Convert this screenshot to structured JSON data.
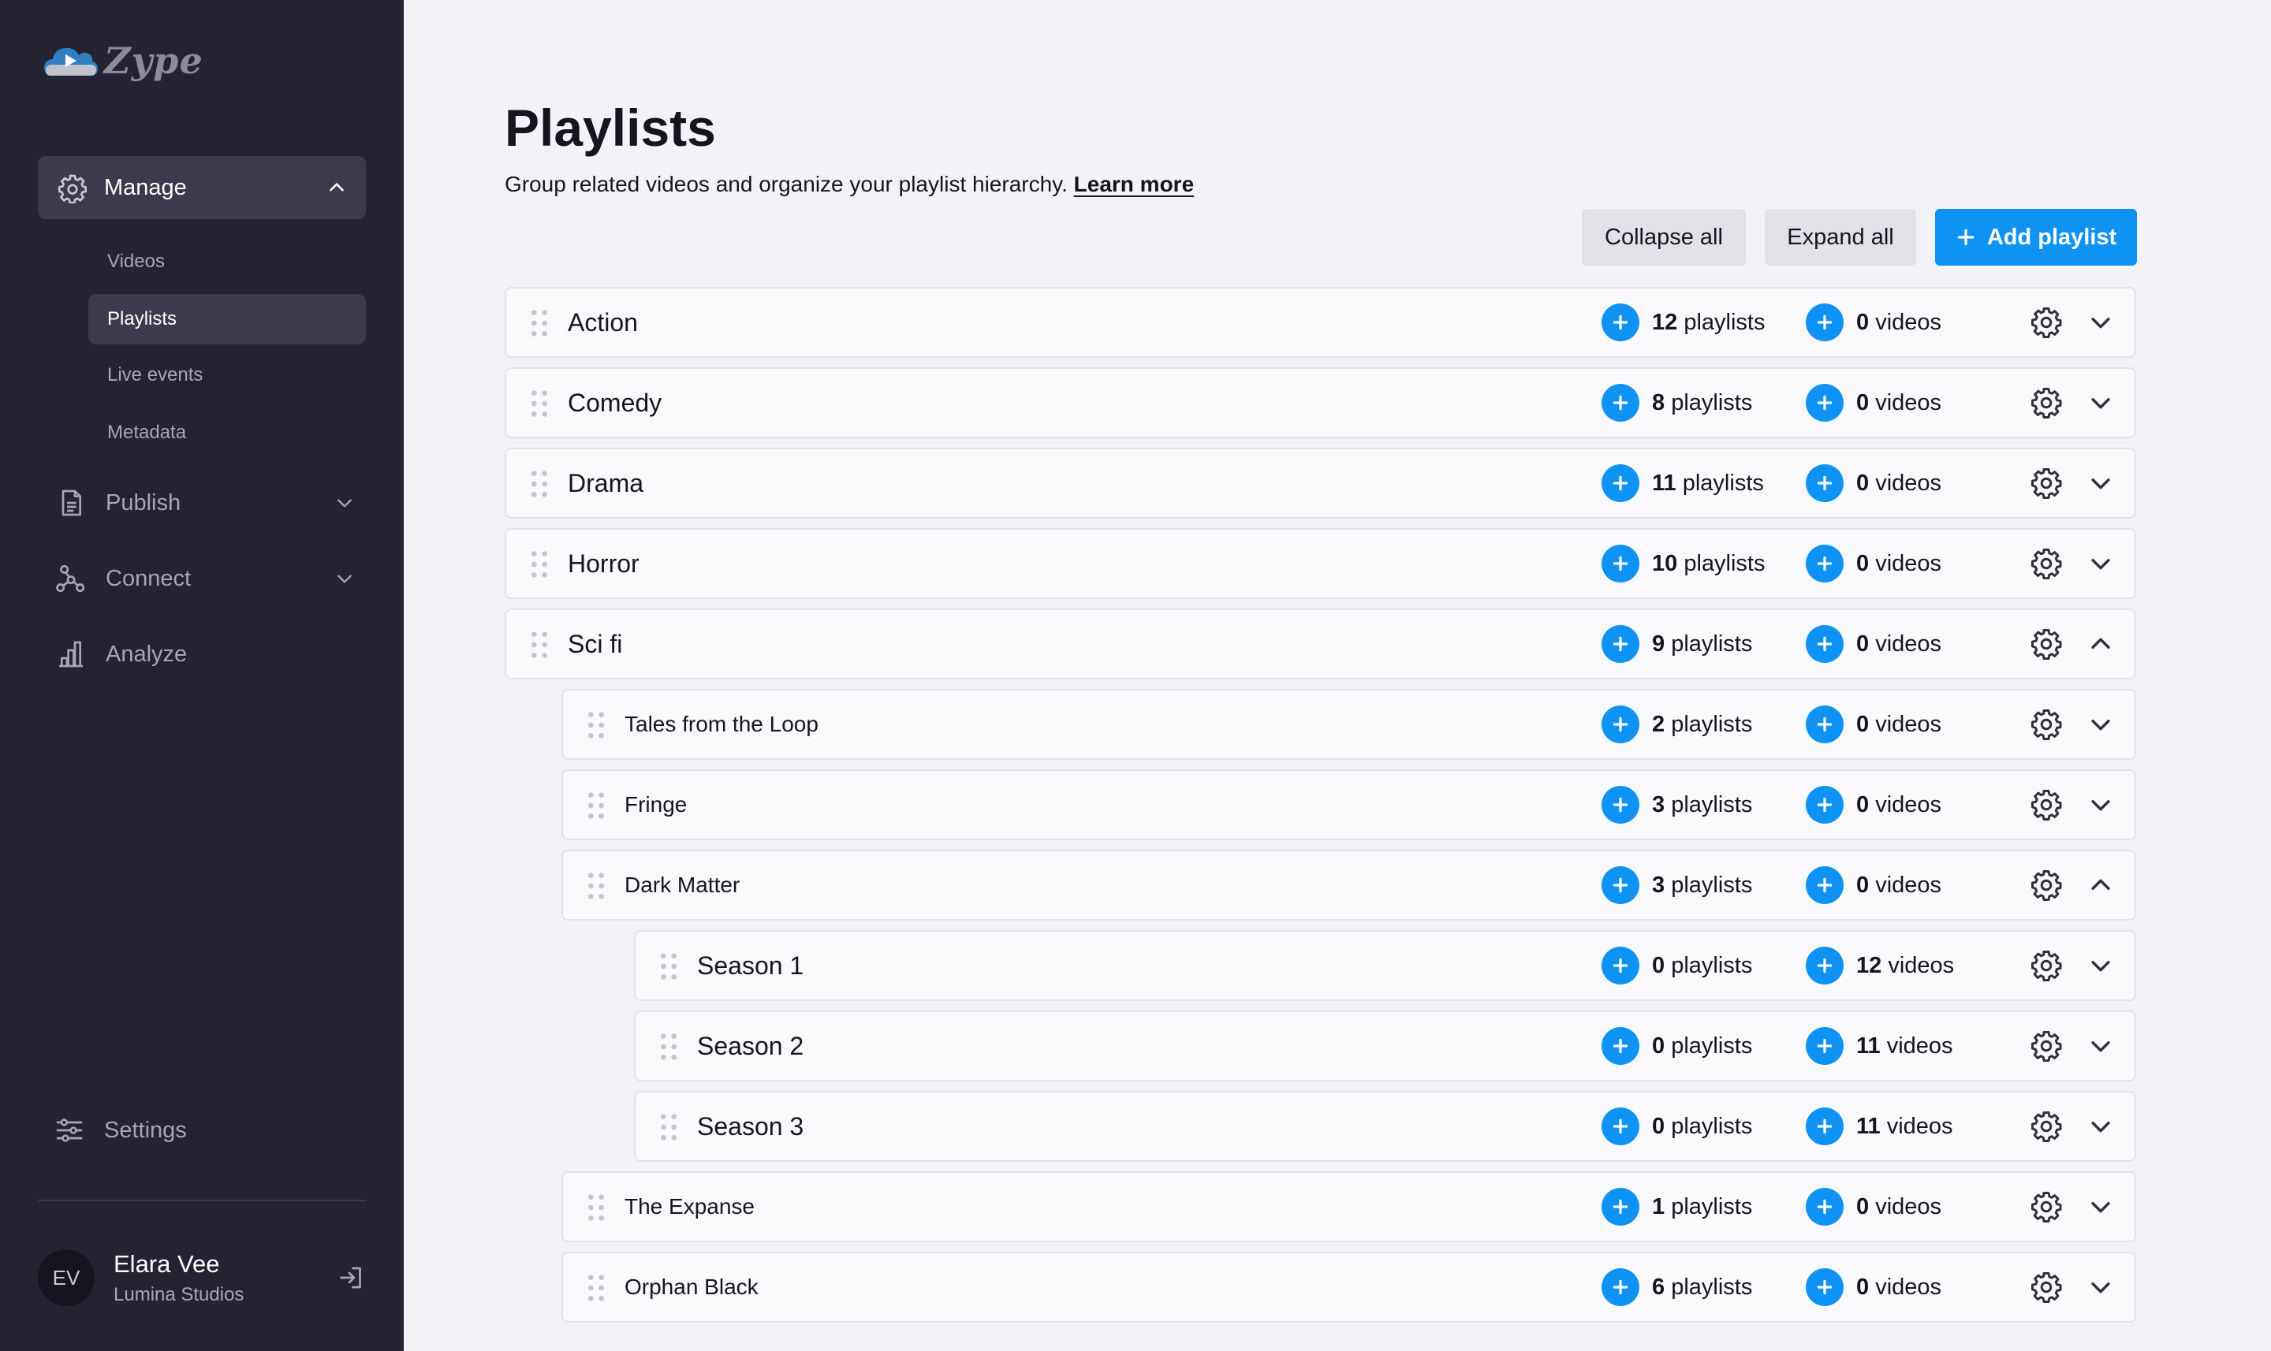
{
  "app": {
    "logo_text": "Zype",
    "brand_color": "#0e93f5"
  },
  "sidebar": {
    "manage": {
      "label": "Manage",
      "icon": "gear-icon",
      "expanded": true,
      "items": [
        {
          "label": "Videos",
          "active": false
        },
        {
          "label": "Playlists",
          "active": true
        },
        {
          "label": "Live events",
          "active": false
        },
        {
          "label": "Metadata",
          "active": false
        }
      ]
    },
    "nav": [
      {
        "label": "Publish",
        "icon": "document-icon",
        "has_chevron": true
      },
      {
        "label": "Connect",
        "icon": "network-icon",
        "has_chevron": true
      },
      {
        "label": "Analyze",
        "icon": "bar-chart-icon",
        "has_chevron": false
      }
    ],
    "settings_label": "Settings",
    "user": {
      "initials": "EV",
      "name": "Elara Vee",
      "org": "Lumina Studios"
    }
  },
  "main": {
    "title": "Playlists",
    "description": "Group related videos and organize your playlist hierarchy.",
    "learn_more": "Learn more",
    "buttons": {
      "collapse_all": "Collapse all",
      "expand_all": "Expand all",
      "add_playlist": "Add playlist"
    },
    "count_labels": {
      "playlists": "playlists",
      "videos": "videos"
    },
    "playlists": [
      {
        "title": "Action",
        "level": 0,
        "playlists": "12",
        "videos": "0",
        "expanded": false
      },
      {
        "title": "Comedy",
        "level": 0,
        "playlists": "8",
        "videos": "0",
        "expanded": false
      },
      {
        "title": "Drama",
        "level": 0,
        "playlists": "11",
        "videos": "0",
        "expanded": false
      },
      {
        "title": "Horror",
        "level": 0,
        "playlists": "10",
        "videos": "0",
        "expanded": false
      },
      {
        "title": "Sci fi",
        "level": 0,
        "playlists": "9",
        "videos": "0",
        "expanded": true
      },
      {
        "title": "Tales from the Loop",
        "level": 1,
        "playlists": "2",
        "videos": "0",
        "expanded": false
      },
      {
        "title": "Fringe",
        "level": 1,
        "playlists": "3",
        "videos": "0",
        "expanded": false
      },
      {
        "title": "Dark Matter",
        "level": 1,
        "playlists": "3",
        "videos": "0",
        "expanded": true
      },
      {
        "title": "Season 1",
        "level": 2,
        "playlists": "0",
        "videos": "12",
        "expanded": false
      },
      {
        "title": "Season 2",
        "level": 2,
        "playlists": "0",
        "videos": "11",
        "expanded": false
      },
      {
        "title": "Season 3",
        "level": 2,
        "playlists": "0",
        "videos": "11",
        "expanded": false
      },
      {
        "title": "The Expanse",
        "level": 1,
        "playlists": "1",
        "videos": "0",
        "expanded": false
      },
      {
        "title": "Orphan Black",
        "level": 1,
        "playlists": "6",
        "videos": "0",
        "expanded": false
      }
    ]
  }
}
